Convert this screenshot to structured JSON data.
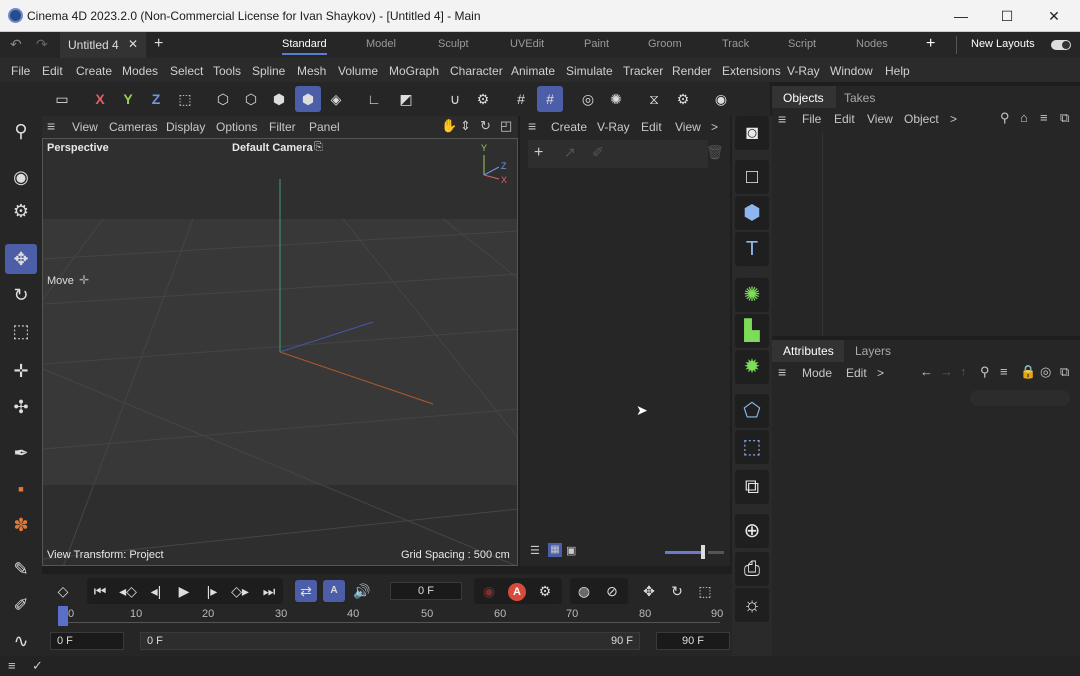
{
  "window": {
    "title": "Cinema 4D 2023.2.0 (Non-Commercial License for Ivan Shaykov) - [Untitled 4] - Main",
    "minimize": "—",
    "maximize": "☐",
    "close": "✕"
  },
  "doc_tab": {
    "label": "Untitled 4",
    "close": "✕",
    "add": "+"
  },
  "layouts": {
    "tabs": [
      "Standard",
      "Model",
      "Sculpt",
      "UVEdit",
      "Paint",
      "Groom",
      "Track",
      "Script",
      "Nodes"
    ],
    "add": "+",
    "new_layouts": "New Layouts"
  },
  "menu": [
    "File",
    "Edit",
    "Create",
    "Modes",
    "Select",
    "Tools",
    "Spline",
    "Mesh",
    "Volume",
    "MoGraph",
    "Character",
    "Animate",
    "Simulate",
    "Tracker",
    "Render",
    "Extensions",
    "V-Ray",
    "Window",
    "Help"
  ],
  "toolbar": {
    "axis_x": "X",
    "axis_y": "Y",
    "axis_z": "Z"
  },
  "viewport": {
    "menu": [
      "View",
      "Cameras",
      "Display",
      "Options",
      "Filter",
      "Panel"
    ],
    "name": "Perspective",
    "camera": "Default Camera",
    "move_label": "Move",
    "view_transform": "View Transform: Project",
    "grid_spacing": "Grid Spacing : 500 cm",
    "axis_y": "Y",
    "axis_z": "Z",
    "axis_x": "X"
  },
  "content_manager": {
    "menu": [
      "Create",
      "V-Ray",
      "Edit",
      "View"
    ],
    "more": ">"
  },
  "objects_panel": {
    "tabs": [
      "Objects",
      "Takes"
    ],
    "menu": [
      "File",
      "Edit",
      "View",
      "Object"
    ],
    "more": ">"
  },
  "attributes_panel": {
    "tabs": [
      "Attributes",
      "Layers"
    ],
    "menu": [
      "Mode",
      "Edit"
    ],
    "more": ">"
  },
  "timeline": {
    "current_frame": "0 F",
    "start_field": "0 F",
    "range_start": "0 F",
    "range_end": "90 F",
    "end_field": "90 F",
    "ticks": [
      "0",
      "10",
      "20",
      "30",
      "40",
      "50",
      "60",
      "70",
      "80",
      "90"
    ],
    "record_letter": "A"
  }
}
